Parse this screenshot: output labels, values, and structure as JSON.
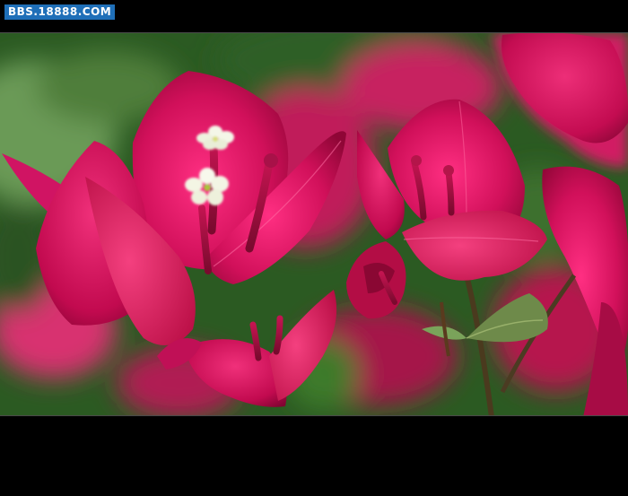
{
  "watermark": {
    "text": "BBS.18888.COM"
  },
  "photo": {
    "subject": "bougainvillea-flowers",
    "accent": "#d1105a",
    "background": "#000000"
  }
}
